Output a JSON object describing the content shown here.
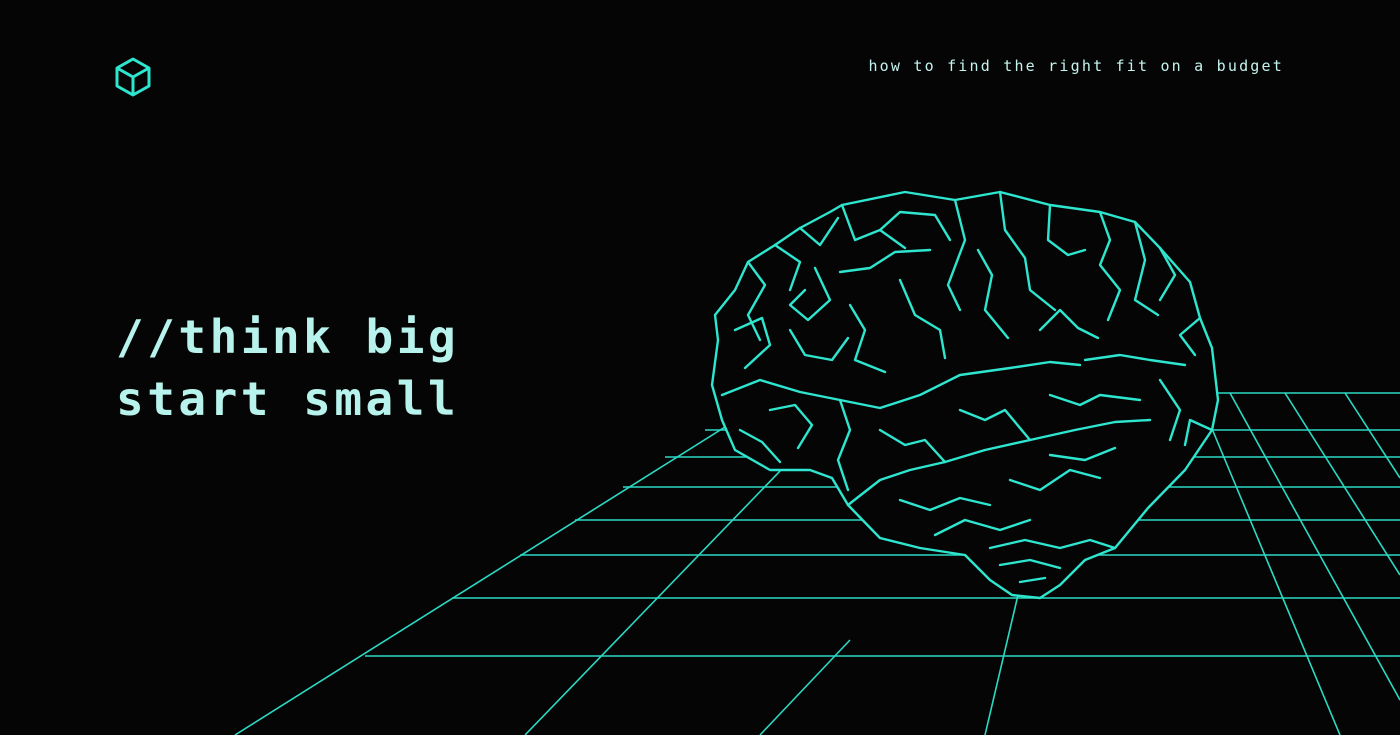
{
  "header": {
    "logo_icon": "cube-icon",
    "tagline": "how to find the right fit on a budget"
  },
  "hero": {
    "line1": "//think big",
    "line2": "start small"
  },
  "illustration": {
    "subject": "brain-icon",
    "floor": "grid-floor"
  },
  "colors": {
    "background": "#050505",
    "accent": "#2ee6cf",
    "text": "#b8f2ec"
  }
}
